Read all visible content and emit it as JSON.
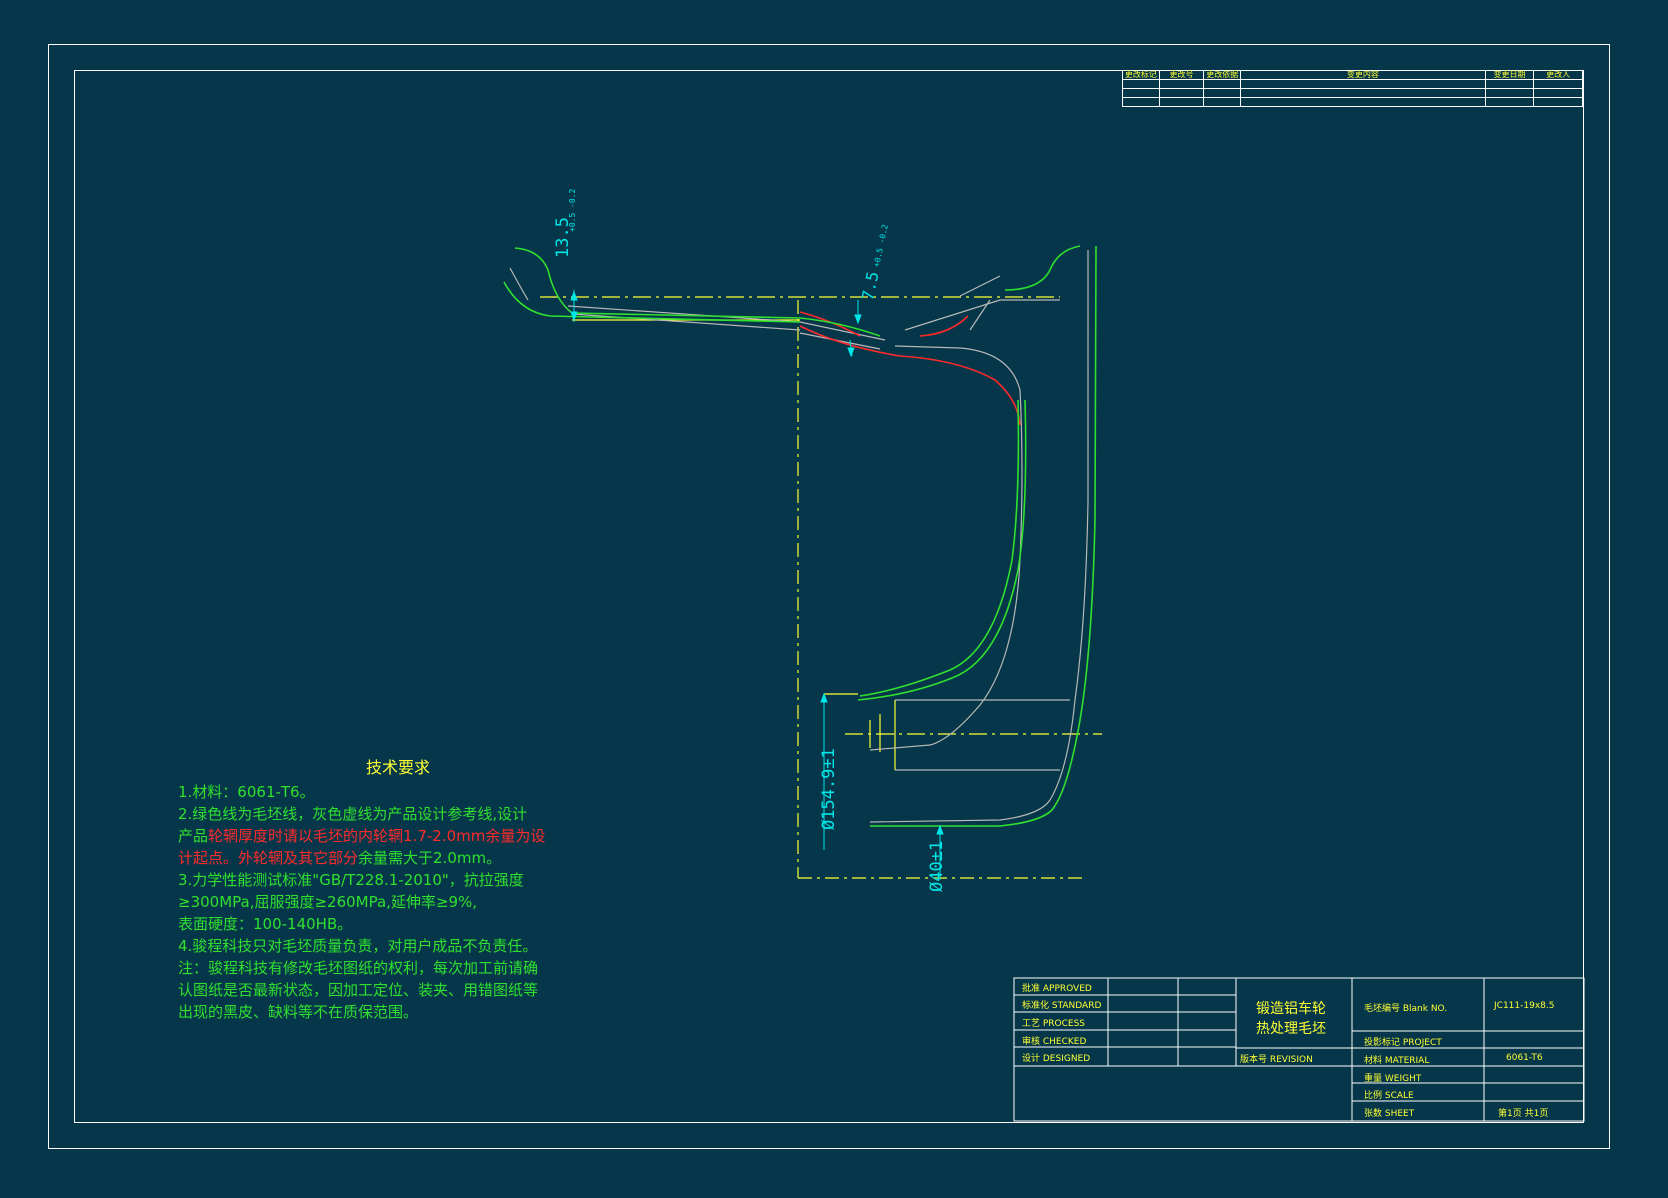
{
  "notes": {
    "title": "技术要求",
    "l1": "1.材料：6061-T6。",
    "l2": "2.绿色线为毛坯线，灰色虚线为产品设计参考线,设计",
    "l3a": "产品",
    "l3b": "轮辋厚度时请以毛坯的内轮辋1.7-2.0mm",
    "l3c": "余量为设",
    "l4a": "计起点。外轮辋及其它部分",
    "l4b": "余量需大于2.0mm。",
    "l5": "3.力学性能测试标准\"GB/T228.1-2010\"，抗拉强度",
    "l6": "≥300MPa,屈服强度≥260MPa,延伸率≥9%,",
    "l7": "表面硬度：100-140HB。",
    "l8": "4.骏程科技只对毛坯质量负责，对用户成品不负责任。",
    "l9": "注：骏程科技有修改毛坯图纸的权利，每次加工前请确",
    "l10": "认图纸是否最新状态，因加工定位、装夹、用错图纸等",
    "l11": "出现的黑皮、缺料等不在质保范围。"
  },
  "revision_table": {
    "headers": [
      "更改标记",
      "更改号",
      "更改依据",
      "变更内容",
      "变更日期",
      "更改人"
    ]
  },
  "dimensions": {
    "d1": "13.5",
    "d1_tol": "+0.5\n-0.2",
    "d2": "7.5",
    "d2_tol": "+0.5\n-0.2",
    "d3": "Ø154.9±1",
    "d4": "Ø40±1"
  },
  "title_block": {
    "approved": "批准  APPROVED",
    "standard": "标准化 STANDARD",
    "process": "工艺  PROCESS",
    "checked": "审核  CHECKED",
    "designed": "设计  DESIGNED",
    "name1": "锻造铝车轮",
    "name2": "热处理毛坯",
    "revision": "版本号 REVISION",
    "blank_no_label": "毛坯编号 Blank NO.",
    "blank_no": "JC111-19x8.5",
    "project": "投影标记 PROJECT",
    "material_label": "材料 MATERIAL",
    "material": "6061-T6",
    "weight": "重量 WEIGHT",
    "scale": "比例 SCALE",
    "sheet_label": "张数 SHEET",
    "sheet": "第1页  共1页"
  },
  "colors": {
    "background": "#05364a",
    "green": "#2fe02f",
    "yellow": "#ffff33",
    "red": "#ff2a2a",
    "gray": "#b8b8b8",
    "cyan": "#00e6e6"
  }
}
